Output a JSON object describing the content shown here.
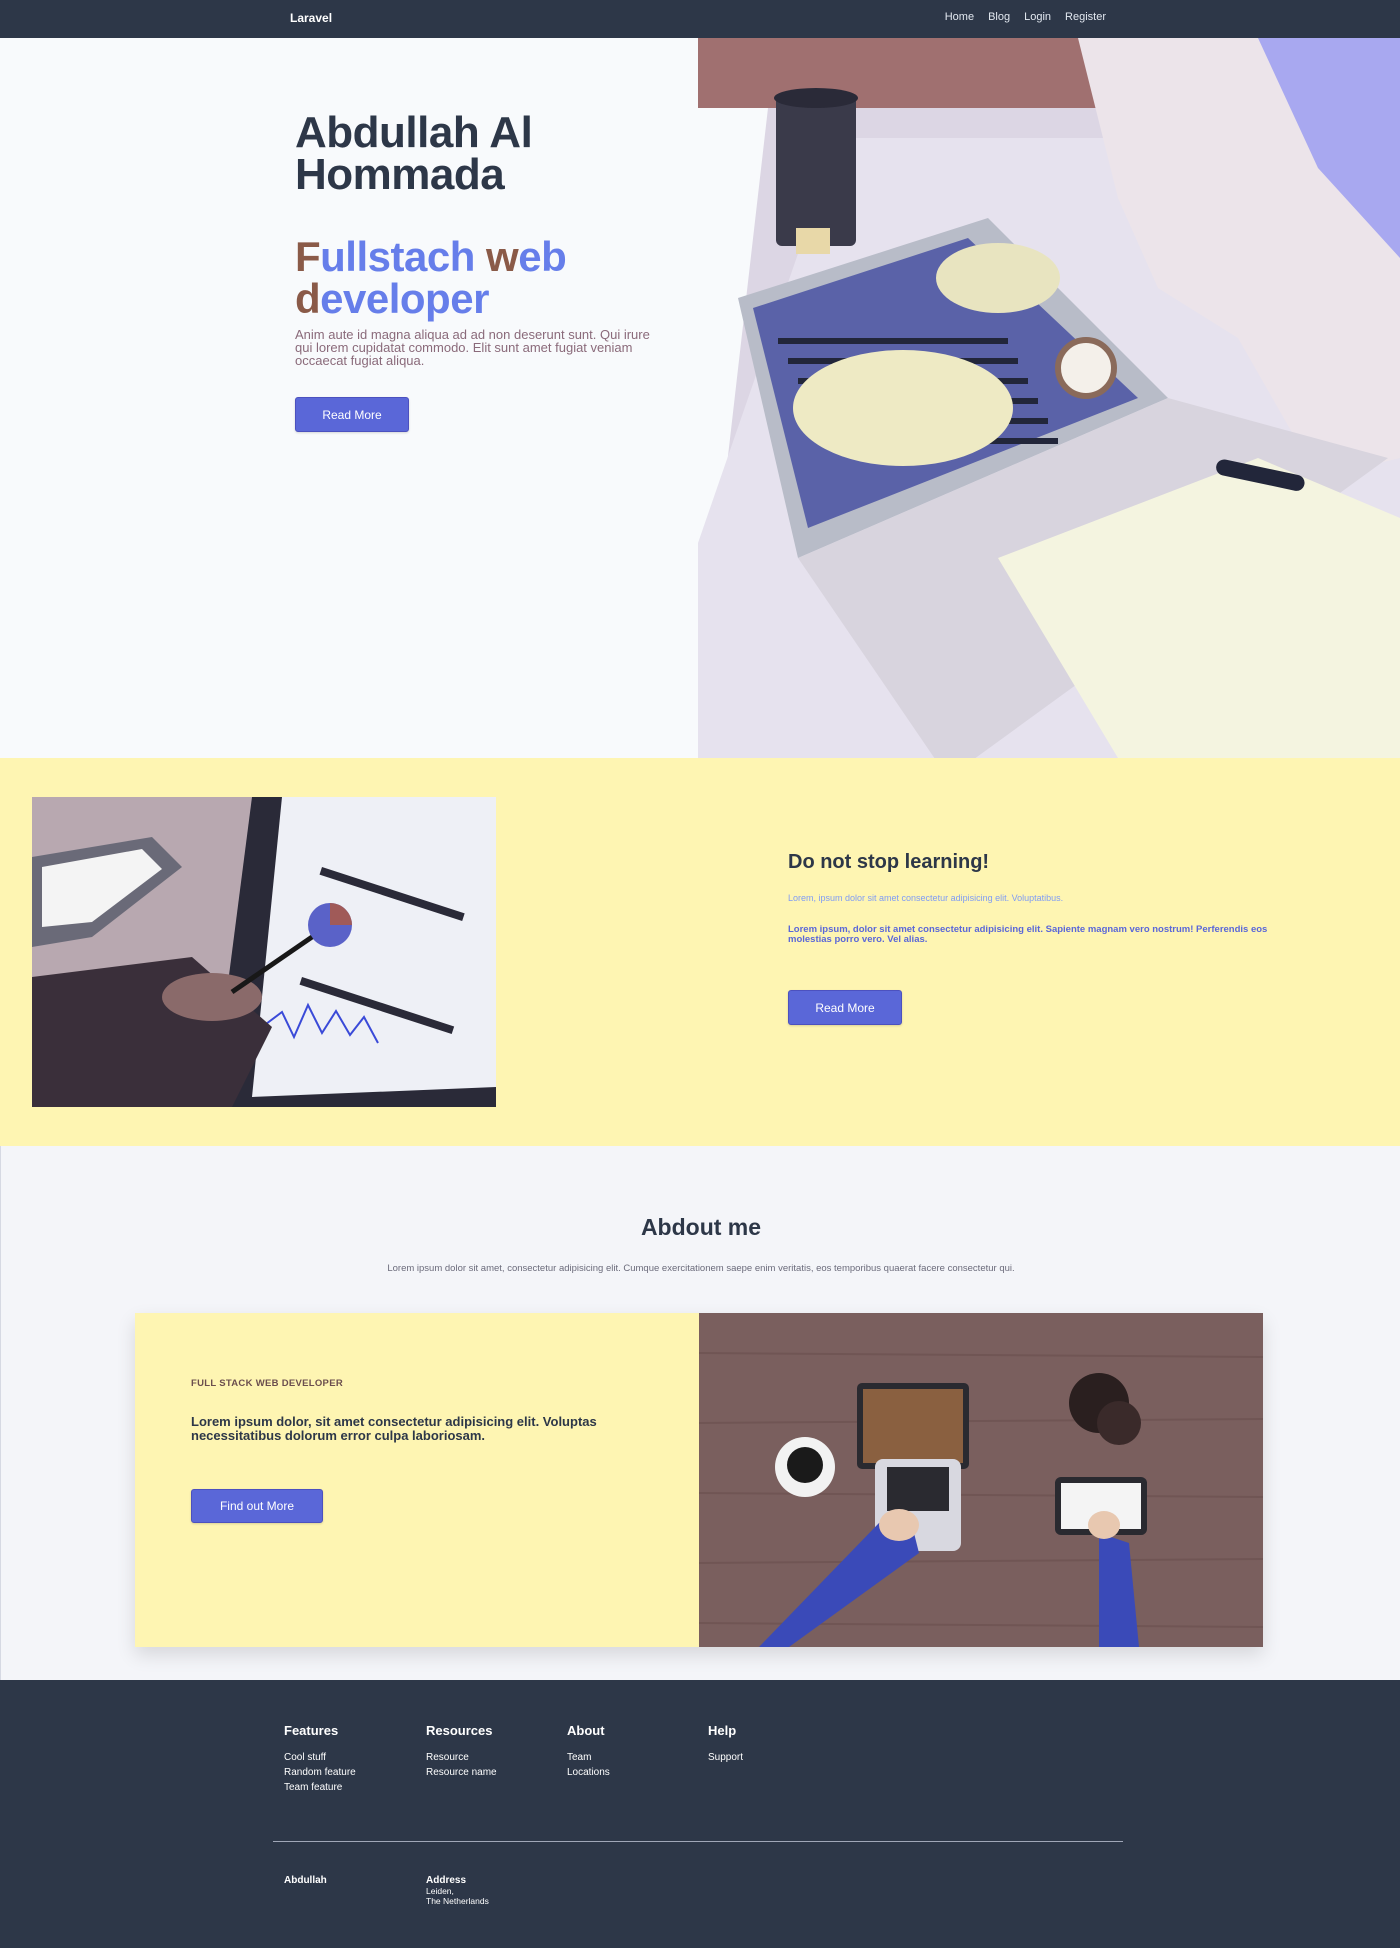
{
  "nav": {
    "brand": "Laravel",
    "links": [
      "Home",
      "Blog",
      "Login",
      "Register"
    ]
  },
  "hero": {
    "name": "Abdullah Al Hommada",
    "role_words": [
      {
        "cap": "F",
        "rest": "ullstach"
      },
      {
        "cap": "w",
        "rest": "eb"
      },
      {
        "cap": "d",
        "rest": "eveloper"
      }
    ],
    "description": "Anim aute id magna aliqua ad ad non deserunt sunt. Qui irure qui lorem cupidatat commodo. Elit sunt amet fugiat veniam occaecat fugiat aliqua.",
    "button": "Read More",
    "image_icon": "laptop-desk-photo"
  },
  "learn": {
    "title": "Do not stop learning!",
    "small_text": "Lorem, ipsum dolor sit amet consectetur adipisicing elit. Voluptatibus.",
    "bold_text": "Lorem ipsum, dolor sit amet consectetur adipisicing elit. Sapiente magnam vero nostrum! Perferendis eos molestias porro vero. Vel alias.",
    "button": "Read More",
    "image_icon": "tablet-chart-photo"
  },
  "about": {
    "title": "Abdout me",
    "subtitle": "Lorem ipsum dolor sit amet, consectetur adipisicing elit. Cumque exercitationem saepe enim veritatis, eos temporibus quaerat facere consectetur qui.",
    "card": {
      "kicker": "FULL STACK WEB DEVELOPER",
      "text": "Lorem ipsum dolor, sit amet consectetur adipisicing elit. Voluptas necessitatibus dolorum error culpa laboriosam.",
      "button": "Find out More",
      "image_icon": "workspace-topdown-photo"
    }
  },
  "footer": {
    "columns": [
      {
        "title": "Features",
        "links": [
          "Cool stuff",
          "Random feature",
          "Team feature"
        ]
      },
      {
        "title": "Resources",
        "links": [
          "Resource",
          "Resource name"
        ]
      },
      {
        "title": "About",
        "links": [
          "Team",
          "Locations"
        ]
      },
      {
        "title": "Help",
        "links": [
          "Support"
        ]
      }
    ],
    "bottom_name": "Abdullah",
    "address_title": "Address",
    "address_lines": [
      "Leiden,",
      "The Netherlands"
    ]
  },
  "colors": {
    "nav_bg": "#2d3748",
    "accent": "#5a67d8",
    "yellow": "#fef5b2",
    "brown": "#8a5a48"
  }
}
